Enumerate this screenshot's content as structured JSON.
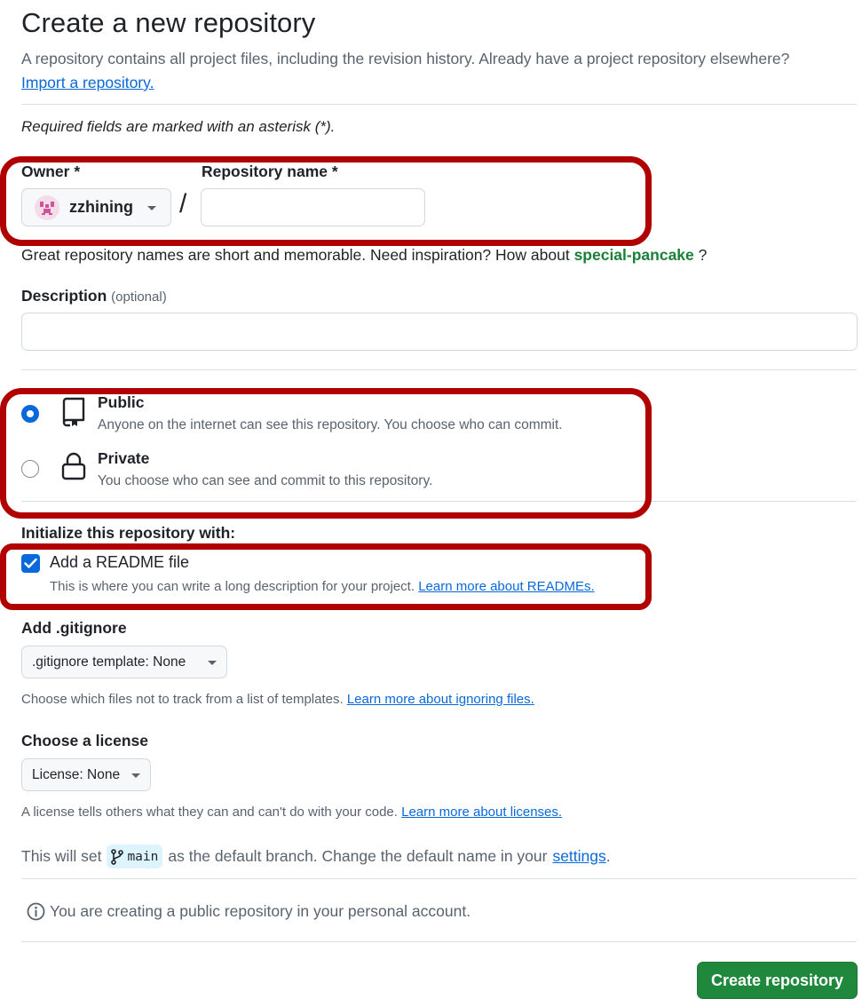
{
  "header": {
    "title": "Create a new repository",
    "subtitle": "A repository contains all project files, including the revision history. Already have a project repository elsewhere?",
    "import_link": "Import a repository."
  },
  "form": {
    "required_note": "Required fields are marked with an asterisk (*).",
    "owner": {
      "label": "Owner *",
      "value": "zzhining",
      "icon": "identicon-avatar"
    },
    "separator": "/",
    "repo_name": {
      "label": "Repository name *",
      "value": ""
    },
    "name_hint": {
      "prefix": "Great repository names are short and memorable. Need inspiration? How about",
      "suggestion": "special-pancake",
      "suffix": "?"
    },
    "description": {
      "label": "Description",
      "optional": "(optional)",
      "value": ""
    },
    "visibility": {
      "selected": "Public",
      "options": [
        {
          "title": "Public",
          "desc": "Anyone on the internet can see this repository. You choose who can commit.",
          "icon": "repo-icon"
        },
        {
          "title": "Private",
          "desc": "You choose who can see and commit to this repository.",
          "icon": "lock-icon"
        }
      ]
    },
    "initialize": {
      "label": "Initialize this repository with:",
      "readme": {
        "checked": true,
        "title": "Add a README file",
        "desc": "This is where you can write a long description for your project.",
        "link": "Learn more about READMEs."
      }
    },
    "gitignore": {
      "label": "Add .gitignore",
      "select": ".gitignore template: None",
      "hint": "Choose which files not to track from a list of templates.",
      "link": "Learn more about ignoring files."
    },
    "license": {
      "label": "Choose a license",
      "select": "License: None",
      "hint": "A license tells others what they can and can't do with your code.",
      "link": "Learn more about licenses."
    },
    "branch_note": {
      "prefix": "This will set",
      "branch": "main",
      "middle": "as the default branch. Change the default name in your",
      "link": "settings",
      "suffix": "."
    },
    "info_note": "You are creating a public repository in your personal account.",
    "submit_label": "Create repository"
  },
  "colors": {
    "accent": "#0969da",
    "primary_button": "#1f883d",
    "suggestion": "#1a7f37",
    "annotation": "#b00000"
  }
}
